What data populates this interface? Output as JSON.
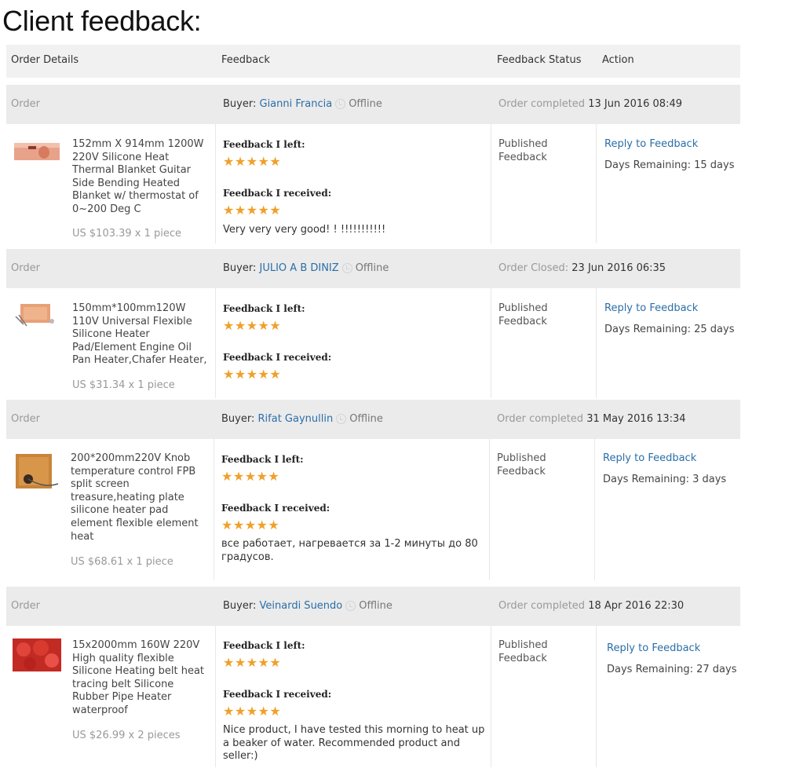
{
  "page": {
    "title": "Client feedback:"
  },
  "table": {
    "headers": [
      "Order Details",
      "Feedback",
      "Feedback Status",
      "Action"
    ]
  },
  "labels": {
    "order": "Order",
    "buyer": "Buyer:",
    "offline": "Offline",
    "feedback_left": "Feedback I left:",
    "feedback_received": "Feedback I received:",
    "published_line1": "Published",
    "published_line2": "Feedback",
    "reply": "Reply to Feedback"
  },
  "colors": {
    "star": "#f0a02a",
    "link": "#2a6ea8",
    "bar": "#ebebeb"
  },
  "orders": [
    {
      "buyer": "Gianni Francia",
      "status_label": "Order completed",
      "status_date": "13 Jun 2016 08:49",
      "product_title": "152mm X 914mm 1200W 220V Silicone Heat Thermal Blanket Guitar Side Bending Heated Blanket w/ thermostat of 0~200 Deg C",
      "price": "US $103.39 x 1 piece",
      "stars_left": "★★★★★",
      "stars_received": "★★★★★",
      "comment": "Very very very good! ! !!!!!!!!!!!",
      "days_remaining": "Days Remaining: 15 days"
    },
    {
      "buyer": "JULIO A B DINIZ",
      "status_label": "Order Closed:",
      "status_date": "23 Jun 2016 06:35",
      "product_title": "150mm*100mm120W 110V Universal Flexible Silicone Heater Pad/Element Engine Oil Pan Heater,Chafer Heater,",
      "price": "US $31.34 x 1 piece",
      "stars_left": "★★★★★",
      "stars_received": "★★★★★",
      "comment": "",
      "days_remaining": "Days Remaining: 25 days"
    },
    {
      "buyer": "Rifat Gaynullin",
      "status_label": "Order completed",
      "status_date": "31 May 2016 13:34",
      "product_title": "200*200mm220V Knob temperature control FPB split screen treasure,heating plate silicone heater pad element flexible element heat",
      "price": "US $68.61 x 1 piece",
      "stars_left": "★★★★★",
      "stars_received": "★★★★★",
      "comment": "все работает, нагревается за 1-2 минуты до 80 градусов.",
      "days_remaining": "Days Remaining: 3 days"
    },
    {
      "buyer": "Veinardi Suendo",
      "status_label": "Order completed",
      "status_date": "18 Apr 2016 22:30",
      "product_title": "15x2000mm 160W 220V High quality flexible Silicone Heating belt heat tracing belt Silicone Rubber Pipe Heater waterproof",
      "price": "US $26.99 x 2 pieces",
      "stars_left": "★★★★★",
      "stars_received": "★★★★★",
      "comment": "Nice product, I have tested this morning to heat up a beaker of water. Recommended product and seller:)",
      "days_remaining": "Days Remaining: 27 days"
    }
  ]
}
